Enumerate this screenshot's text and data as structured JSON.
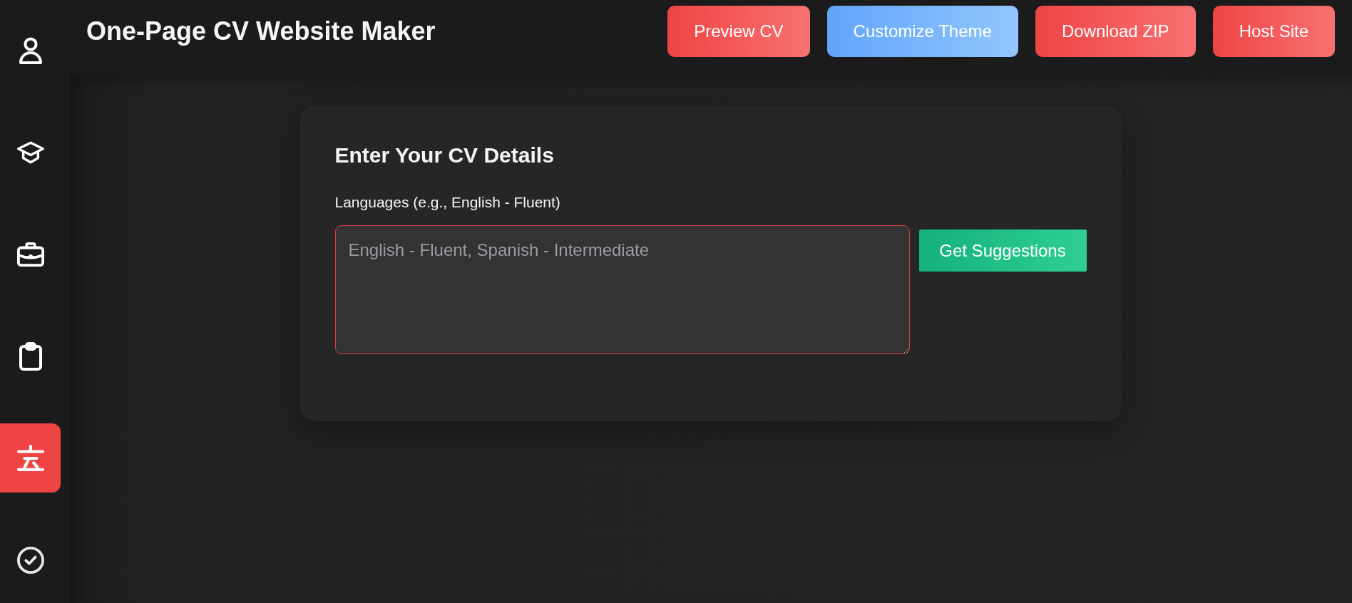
{
  "sidebar": {
    "items": [
      {
        "kind": "person",
        "selected": false
      },
      {
        "kind": "cap",
        "selected": false
      },
      {
        "kind": "briefcase",
        "selected": false
      },
      {
        "kind": "clipboard",
        "selected": false
      },
      {
        "kind": "language",
        "selected": true
      },
      {
        "kind": "check",
        "selected": false
      }
    ]
  },
  "header": {
    "title": "One-Page CV Website Maker",
    "buttons": [
      {
        "label": "Preview CV",
        "kind": "red"
      },
      {
        "label": "Customize Theme",
        "kind": "blue"
      },
      {
        "label": "Download ZIP",
        "kind": "red"
      },
      {
        "label": "Host Site",
        "kind": "red"
      }
    ]
  },
  "form": {
    "title": "Enter Your CV Details",
    "fields": [
      {
        "label": "Languages (e.g., English - Fluent)",
        "placeholder": "English - Fluent, Spanish - Intermediate",
        "focused": true,
        "action": "Get Suggestions"
      }
    ]
  }
}
